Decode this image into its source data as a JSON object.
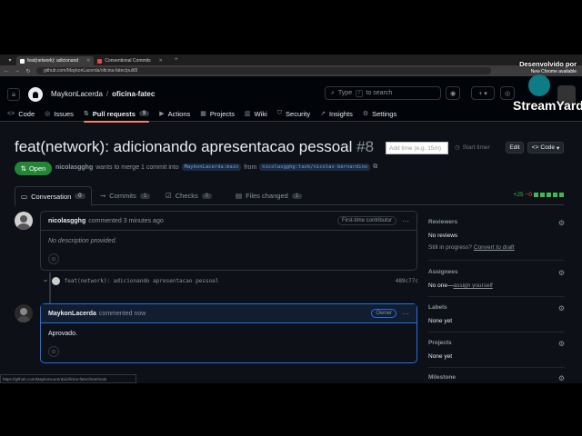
{
  "browser": {
    "tabs": [
      {
        "label": "feat(network): adicionand",
        "active": true
      },
      {
        "label": "Conventional Commits",
        "active": false
      }
    ],
    "url": "github.com/MaykonLacerda/oficina-fatec/pull/8"
  },
  "header": {
    "owner": "MaykonLacerda",
    "separator": "/",
    "repo": "oficina-fatec",
    "search_placeholder": "Type",
    "search_key": "/",
    "search_suffix": "to search"
  },
  "repo_nav": [
    {
      "label": "Code",
      "icon": "<>"
    },
    {
      "label": "Issues",
      "icon": "◎"
    },
    {
      "label": "Pull requests",
      "icon": "⇅",
      "count": "9",
      "active": true
    },
    {
      "label": "Actions",
      "icon": "▶"
    },
    {
      "label": "Projects",
      "icon": "▦"
    },
    {
      "label": "Wiki",
      "icon": "▥"
    },
    {
      "label": "Security",
      "icon": "⛉"
    },
    {
      "label": "Insights",
      "icon": "↗"
    },
    {
      "label": "Settings",
      "icon": "⚙"
    }
  ],
  "pr": {
    "title": "feat(network): adicionando apresentacao pessoal",
    "number": "#8",
    "add_time_placeholder": "Add time (e.g. 15m)",
    "start_timer": "Start timer",
    "edit": "Edit",
    "code": "Code",
    "state": "Open",
    "author": "nicolasgghg",
    "merge_text": "wants to merge 1 commit into",
    "base_branch": "MaykonLacerda:main",
    "from": "from",
    "head_branch": "nicolasgghg:task/nicolas-bernardino"
  },
  "pr_tabs": [
    {
      "label": "Conversation",
      "count": "0",
      "active": true
    },
    {
      "label": "Commits",
      "count": "1"
    },
    {
      "label": "Checks",
      "count": "0"
    },
    {
      "label": "Files changed",
      "count": "1"
    }
  ],
  "diffstat": {
    "additions": "+25",
    "deletions": "−0"
  },
  "comments": [
    {
      "author": "nicolasgghg",
      "time": "commented 3 minutes ago",
      "badge": "First-time contributor",
      "body": "No description provided.",
      "italic": true
    },
    {
      "author": "MaykonLacerda",
      "time": "commented now",
      "badge": "Owner",
      "body": "Aprovado.",
      "italic": false
    }
  ],
  "commit": {
    "message": "feat(network): adicionando apresentacao pessoal",
    "sha": "489c77c"
  },
  "sidebar": {
    "reviewers": {
      "title": "Reviewers",
      "value": "No reviews",
      "in_progress": "Still in progress?",
      "convert": "Convert to draft"
    },
    "assignees": {
      "title": "Assignees",
      "value": "No one—",
      "assign": "assign yourself"
    },
    "labels": {
      "title": "Labels",
      "value": "None yet"
    },
    "projects": {
      "title": "Projects",
      "value": "None yet"
    },
    "milestone": {
      "title": "Milestone"
    }
  },
  "statusbar": "https://github.com/MaykonLacerda/oficina-fatec/tree/main",
  "overlay": {
    "line1": "Desenvolvido por",
    "line2": "New Chrome available",
    "brand": "StreamYard"
  }
}
